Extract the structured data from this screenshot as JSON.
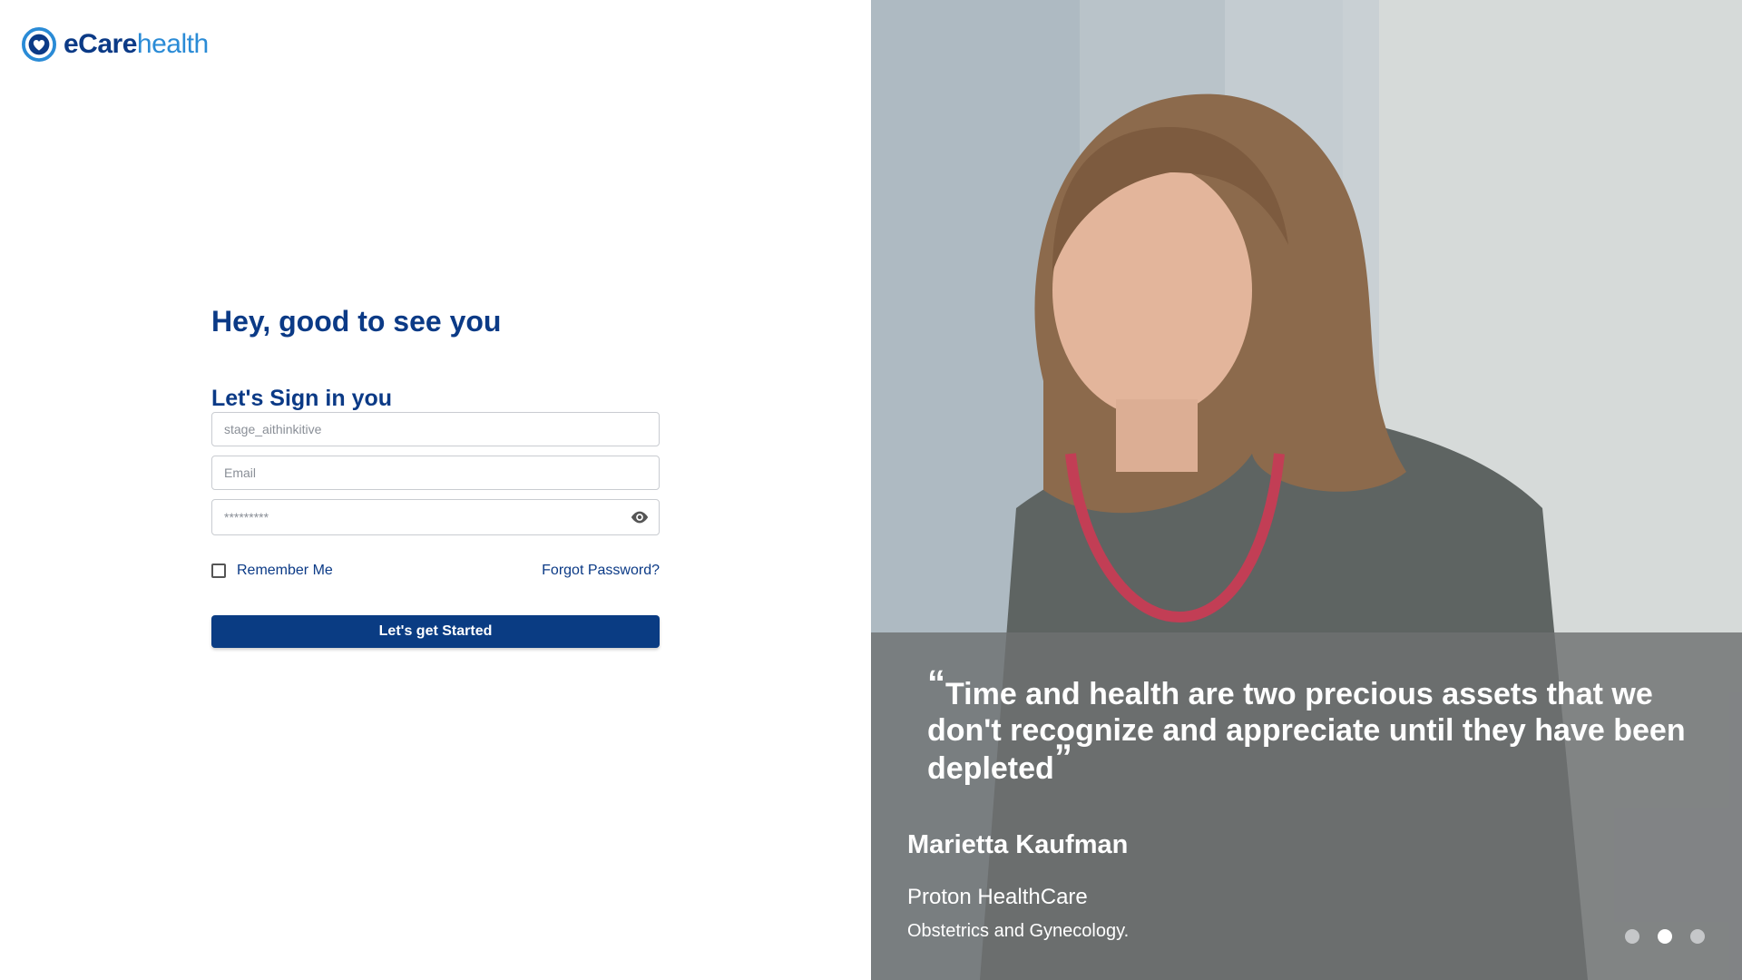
{
  "brand": {
    "name_bold": "eCare",
    "name_light": "health",
    "logo_icon": "heart-logo-icon"
  },
  "form": {
    "greeting": "Hey, good to see you",
    "subtitle": "Let's Sign in you",
    "tenant_value": "stage_aithinkitive",
    "email_placeholder": "Email",
    "password_value": "*********",
    "remember_label": "Remember Me",
    "forgot_label": "Forgot Password?",
    "submit_label": "Let's get Started"
  },
  "testimonial": {
    "quote": "Time and health are two precious assets that we don't recognize and appreciate until they have been depleted",
    "open_mark": "“",
    "close_mark": "”",
    "name": "Marietta Kaufman",
    "organization": "Proton HealthCare",
    "specialty": "Obstetrics and Gynecology.",
    "slides": 3,
    "active_slide": 2
  },
  "colors": {
    "primary": "#0a3c83",
    "accent": "#2a8bd6"
  }
}
